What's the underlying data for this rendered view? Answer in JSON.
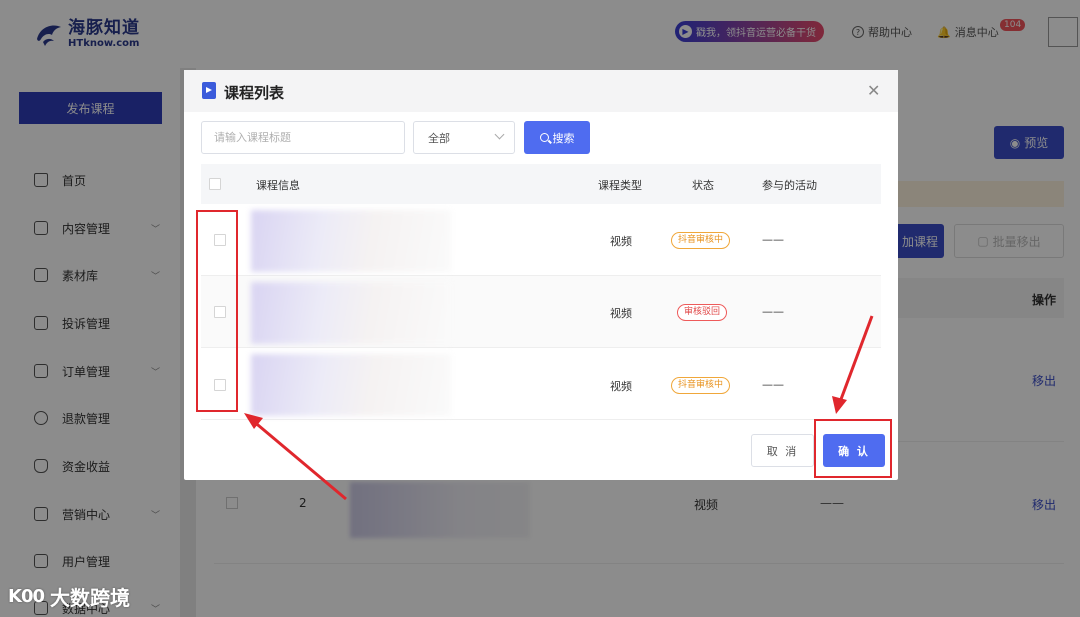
{
  "header": {
    "logo_cn": "海豚知道",
    "logo_en": "HTknow.com",
    "promo_text": "戳我，领抖音运营必备干货",
    "help_label": "帮助中心",
    "messages_label": "消息中心",
    "messages_count": "104"
  },
  "sidebar": {
    "publish_label": "发布课程",
    "items": [
      {
        "label": "首页",
        "icon": "home-icon",
        "has_submenu": false
      },
      {
        "label": "内容管理",
        "icon": "content-icon",
        "has_submenu": true
      },
      {
        "label": "素材库",
        "icon": "folder-icon",
        "has_submenu": true
      },
      {
        "label": "投诉管理",
        "icon": "complaint-icon",
        "has_submenu": false
      },
      {
        "label": "订单管理",
        "icon": "order-icon",
        "has_submenu": true
      },
      {
        "label": "退款管理",
        "icon": "refund-icon",
        "has_submenu": false
      },
      {
        "label": "资金收益",
        "icon": "money-icon",
        "has_submenu": false
      },
      {
        "label": "营销中心",
        "icon": "marketing-icon",
        "has_submenu": true
      },
      {
        "label": "用户管理",
        "icon": "user-icon",
        "has_submenu": false
      },
      {
        "label": "数据中心",
        "icon": "data-icon",
        "has_submenu": true
      }
    ]
  },
  "main": {
    "preview_label": "预览",
    "add_course_label": "加课程",
    "batch_remove_label": "批量移出",
    "operation_header": "操作",
    "remove_label": "移出",
    "row2": {
      "index": "2",
      "type": "视频",
      "activity": "——"
    }
  },
  "modal": {
    "title": "课程列表",
    "search_placeholder": "请输入课程标题",
    "search_value": "",
    "type_filter": "全部",
    "search_button": "搜索",
    "columns": [
      "课程信息",
      "课程类型",
      "状态",
      "参与的活动"
    ],
    "rows": [
      {
        "type": "视频",
        "status": "抖音审核中",
        "status_kind": "pending",
        "activity": "——"
      },
      {
        "type": "视频",
        "status": "审核驳回",
        "status_kind": "rejected",
        "activity": "——"
      },
      {
        "type": "视频",
        "status": "抖音审核中",
        "status_kind": "pending",
        "activity": "——"
      }
    ],
    "cancel_label": "取 消",
    "confirm_label": "确 认"
  },
  "watermark": {
    "mark": "K00",
    "text": "大数跨境"
  },
  "colors": {
    "primary": "#4f6cf0",
    "brand_dark": "#2e3db8",
    "annotation_red": "#e0272d",
    "pending_orange": "#e89320",
    "rejected_red": "#e04848"
  }
}
